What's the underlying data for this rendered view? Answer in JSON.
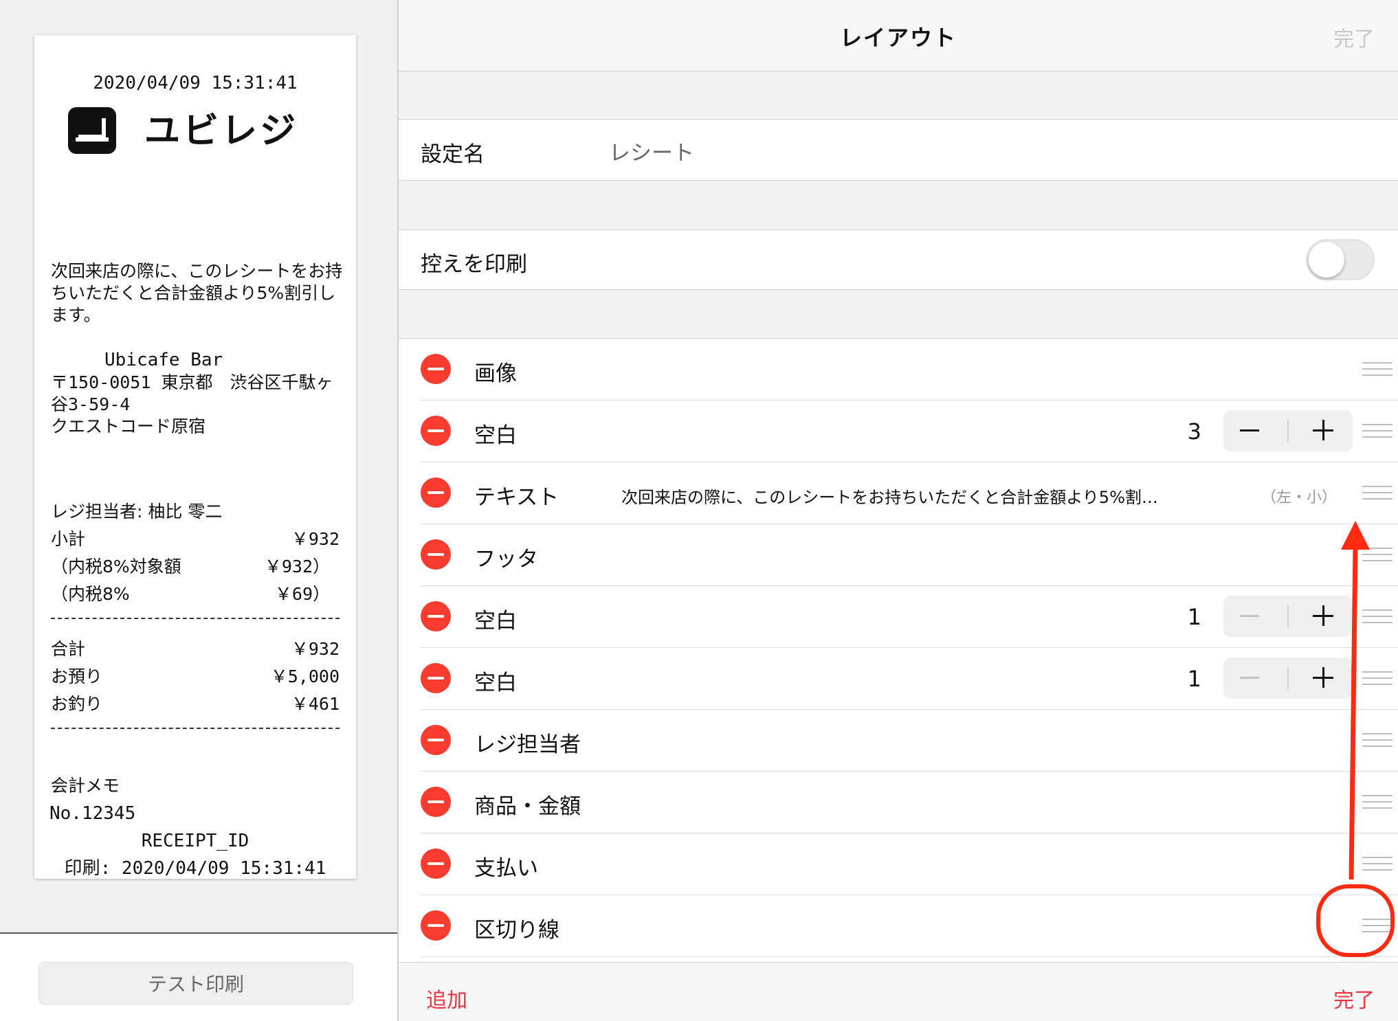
{
  "receipt": {
    "datetime": "2020/04/09 15:31:41",
    "logo_text": "ユビレジ",
    "message": "次回来店の際に、このレシートをお持ちいただくと合計金額より5%割引します。",
    "shop_name": "Ubicafe Bar",
    "address_line1": "〒150-0051 東京都　渋谷区千駄ヶ谷3-59-4",
    "address_line2": "クエストコード原宿",
    "cashier_label": "レジ担当者: 柚比 零二",
    "subtotal_label": "小計",
    "subtotal_value": "￥932",
    "tax_base_label": "（内税8%対象額",
    "tax_base_value": "￥932）",
    "tax_label": "（内税8%",
    "tax_value": "￥69）",
    "total_label": "合計",
    "total_value": "￥932",
    "deposit_label": "お預り",
    "deposit_value": "￥5,000",
    "change_label": "お釣り",
    "change_value": "￥461",
    "memo_label": "会計メモ",
    "memo_no": "No.12345",
    "receipt_id": "RECEIPT_ID",
    "printed": "印刷: 2020/04/09 15:31:41"
  },
  "left_footer": {
    "test_print_label": "テスト印刷"
  },
  "nav": {
    "title": "レイアウト",
    "done_label": "完了"
  },
  "settings": {
    "name_label": "設定名",
    "name_value": "レシート",
    "copy_label": "控えを印刷",
    "copy_enabled": false
  },
  "layout_items": [
    {
      "label": "画像"
    },
    {
      "label": "空白",
      "count": "3"
    },
    {
      "label": "テキスト",
      "text": "次回来店の際に、このレシートをお持ちいただくと合計金額より5%割…",
      "hint": "（左・小）"
    },
    {
      "label": "フッタ"
    },
    {
      "label": "空白",
      "count": "1"
    },
    {
      "label": "空白",
      "count": "1"
    },
    {
      "label": "レジ担当者"
    },
    {
      "label": "商品・金額"
    },
    {
      "label": "支払い"
    },
    {
      "label": "区切り線"
    }
  ],
  "toolbar": {
    "add_label": "追加",
    "done_label": "完了"
  },
  "colors": {
    "delete_red": "#fa3b30",
    "accent_red": "#f0303f",
    "annotation_red": "#ff2a12"
  }
}
